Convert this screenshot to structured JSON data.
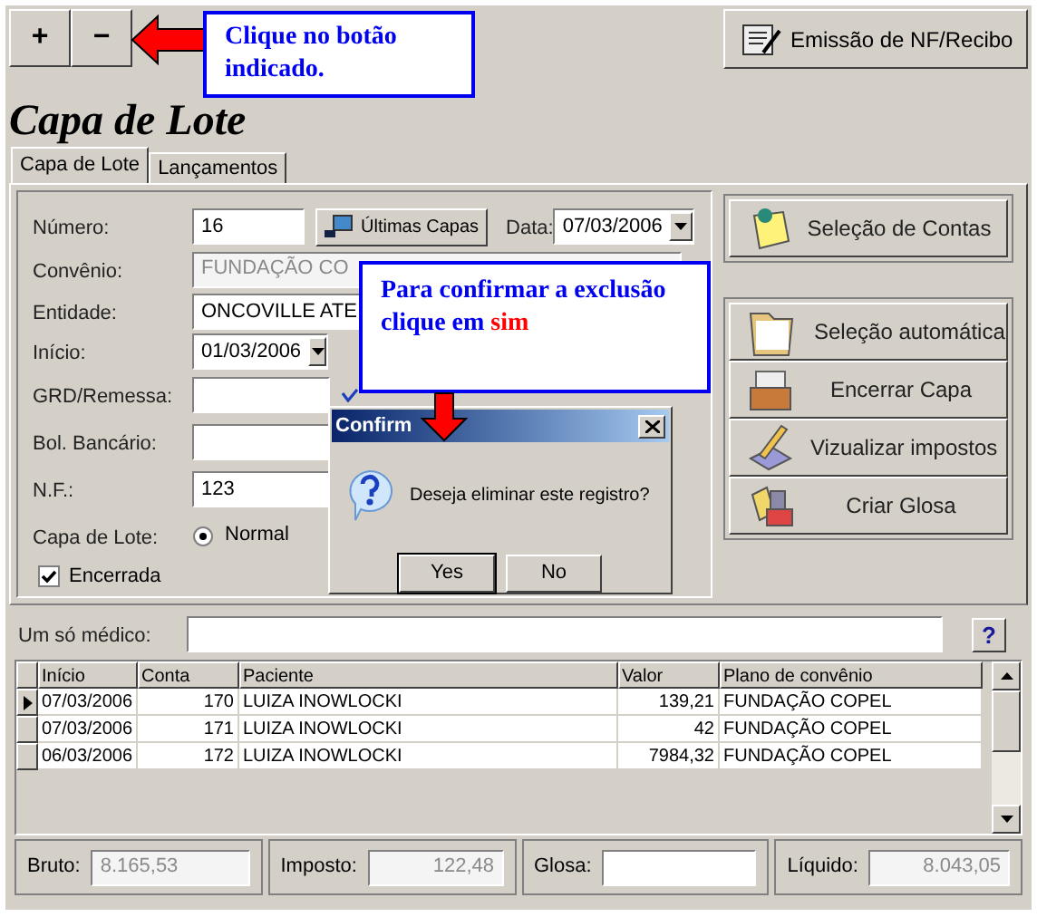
{
  "toolbar": {
    "buttons": [
      {
        "label": "+"
      },
      {
        "label": "−"
      }
    ],
    "report_button": {
      "label": "Emissão de NF/Recibo"
    }
  },
  "callouts": [
    {
      "text": "Clique no botão indicado."
    },
    {
      "text": "Para confirmar a exclusão clique em",
      "highlight": "sim"
    }
  ],
  "title": "Capa de Lote",
  "tabs": [
    {
      "label": "Capa de Lote",
      "selected": true
    },
    {
      "label": "Lançamentos",
      "selected": false
    }
  ],
  "form": {
    "numero": {
      "label": "Número:",
      "value": "16"
    },
    "ultimas_button": "Últimas Capas",
    "data": {
      "label": "Data:",
      "value": "07/03/2006"
    },
    "convenio": {
      "label": "Convênio:",
      "value": "FUNDAÇÃO CO",
      "disabled": true
    },
    "entidade": {
      "label": "Entidade:",
      "value": "ONCOVILLE ATE"
    },
    "inicio": {
      "label": "Início:",
      "value": "01/03/2006"
    },
    "grd": {
      "label": "GRD/Remessa:"
    },
    "bol": {
      "label": "Bol. Bancário:"
    },
    "nf": {
      "label": "N.F.:",
      "value": "123"
    },
    "capa": {
      "label": "Capa de Lote:",
      "option": "Normal",
      "selected": true
    },
    "encerrada": {
      "label": "Encerrada",
      "checked": true
    }
  },
  "side_buttons": [
    {
      "label": "Seleção de Contas",
      "kind": "note"
    }
  ],
  "action_buttons": [
    {
      "label": "Seleção automática",
      "kind": "folder"
    },
    {
      "label": "Encerrar Capa",
      "kind": "box"
    },
    {
      "label": "Vizualizar impostos",
      "kind": "tools"
    },
    {
      "label": "Criar Glosa",
      "kind": "glosa"
    }
  ],
  "doctor": {
    "label": "Um só médico:",
    "help": "?"
  },
  "table": {
    "columns": [
      "Início",
      "Conta",
      "Paciente",
      "Valor",
      "Plano de convênio"
    ],
    "rows": [
      {
        "cells": [
          "07/03/2006",
          "170",
          "LUIZA INOWLOCKI",
          "139,21",
          "FUNDAÇÃO COPEL"
        ],
        "selected": true
      },
      {
        "cells": [
          "07/03/2006",
          "171",
          "LUIZA INOWLOCKI",
          "42",
          "FUNDAÇÃO COPEL"
        ],
        "selected": false
      },
      {
        "cells": [
          "06/03/2006",
          "172",
          "LUIZA INOWLOCKI",
          "7984,32",
          "FUNDAÇÃO COPEL"
        ],
        "selected": false
      }
    ]
  },
  "totals": [
    {
      "label": "Bruto:",
      "value": "8.165,53",
      "disabled": true
    },
    {
      "label": "Imposto:",
      "value": "122,48",
      "disabled": true
    },
    {
      "label": "Glosa:"
    },
    {
      "label": "Líquido:",
      "value": "8.043,05",
      "disabled": true
    }
  ],
  "dialog": {
    "title": "Confirm",
    "message": "Deseja eliminar este registro?",
    "buttons": [
      {
        "label": "Yes",
        "default": true
      },
      {
        "label": "No",
        "default": false
      }
    ]
  }
}
